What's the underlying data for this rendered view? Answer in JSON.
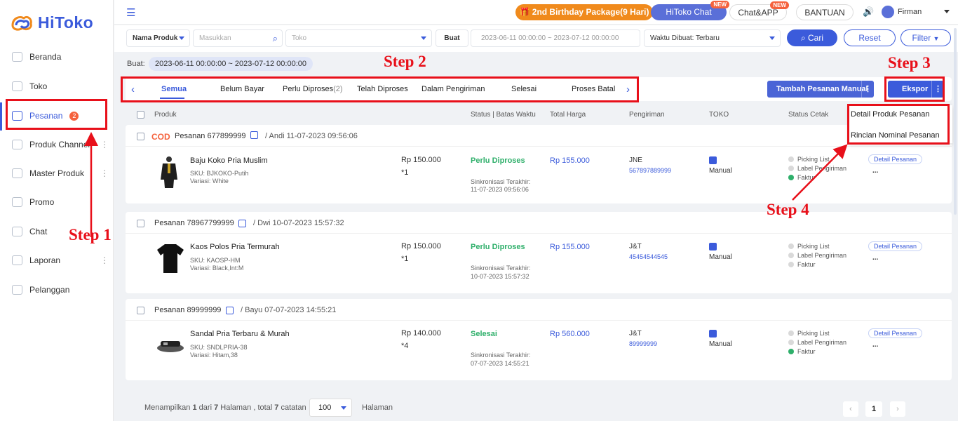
{
  "brand": {
    "name": "HiToko"
  },
  "sidebar": {
    "items": [
      {
        "label": "Beranda",
        "icon": "home-icon"
      },
      {
        "label": "Toko",
        "icon": "store-icon"
      },
      {
        "label": "Pesanan",
        "icon": "orders-icon",
        "badge": "2",
        "active": true
      },
      {
        "label": "Produk Channel",
        "icon": "grid-icon",
        "more": "⋮"
      },
      {
        "label": "Master Produk",
        "icon": "box-icon",
        "more": "⋮"
      },
      {
        "label": "Promo",
        "icon": "promo-icon"
      },
      {
        "label": "Chat",
        "icon": "chat-icon"
      },
      {
        "label": "Laporan",
        "icon": "report-icon",
        "more": "⋮"
      },
      {
        "label": "Pelanggan",
        "icon": "users-icon"
      }
    ]
  },
  "topbar": {
    "birthday": "2nd Birthday Package(9 Hari)",
    "chat": "HiToko Chat",
    "chatapp": "Chat&APP",
    "bantuan": "BANTUAN",
    "new_tag": "NEW",
    "user": "Firman"
  },
  "filters": {
    "field_select": "Nama Produk",
    "search_placeholder": "Masukkan",
    "toko_placeholder": "Toko",
    "date_label": "Buat",
    "date_start": "2023-06-11 00:00:00",
    "date_sep": "~",
    "date_end": "2023-07-12 00:00:00",
    "sort": "Waktu Dibuat: Terbaru",
    "cari": "Cari",
    "reset": "Reset",
    "filter": "Filter"
  },
  "active_filter": {
    "label": "Buat:",
    "value": "2023-06-11 00:00:00 ~ 2023-07-12 00:00:00"
  },
  "tabs": [
    {
      "label": "Semua"
    },
    {
      "label": "Belum Bayar"
    },
    {
      "label": "Perlu Diproses",
      "count": "(2)"
    },
    {
      "label": "Telah Diproses"
    },
    {
      "label": "Dalam Pengiriman"
    },
    {
      "label": "Selesai"
    },
    {
      "label": "Proses Batal"
    }
  ],
  "actions": {
    "manual": "Tambah Pesanan Manual",
    "ekspor": "Ekspor",
    "more": "⋮"
  },
  "export_menu": [
    "Detail Produk Pesanan",
    "Rincian Nominal Pesanan"
  ],
  "columns": {
    "produk": "Produk",
    "status": "Status | Batas Waktu",
    "total": "Total Harga",
    "pengiriman": "Pengiriman",
    "toko": "TOKO",
    "cetak": "Status Cetak"
  },
  "orders": [
    {
      "cod": "COD",
      "order_label": "Pesanan 677899999",
      "meta": "/ Andi 11-07-2023 09:56:06",
      "product": "Baju Koko Pria Muslim",
      "sku": "SKU:  BJKOKO-Putih",
      "variasi": "Variasi:  White",
      "price": "Rp 150.000",
      "qty": "*1",
      "status": "Perlu Diproses",
      "sync_label": "Sinkronisasi Terakhir:",
      "sync_time": "11-07-2023 09:56:06",
      "total": "Rp 155.000",
      "courier": "JNE",
      "tracking": "567897889999",
      "toko": "Manual",
      "print": [
        "Picking List",
        "Label Pengiriman",
        "Faktur"
      ],
      "detail": "Detail Pesanan",
      "more": "..."
    },
    {
      "cod": "",
      "order_label": "Pesanan 78967799999",
      "meta": "/ Dwi 10-07-2023 15:57:32",
      "product": "Kaos Polos Pria Termurah",
      "sku": "SKU:  KAOSP-HM",
      "variasi": "Variasi:  Black,Int:M",
      "price": "Rp 150.000",
      "qty": "*1",
      "status": "Perlu Diproses",
      "sync_label": "Sinkronisasi Terakhir:",
      "sync_time": "10-07-2023 15:57:32",
      "total": "Rp 155.000",
      "courier": "J&T",
      "tracking": "45454544545",
      "toko": "Manual",
      "print": [
        "Picking List",
        "Label Pengiriman",
        "Faktur"
      ],
      "detail": "Detail Pesanan",
      "more": "..."
    },
    {
      "cod": "",
      "order_label": "Pesanan 89999999",
      "meta": "/ Bayu 07-07-2023 14:55:21",
      "product": "Sandal Pria Terbaru & Murah",
      "sku": "SKU:  SNDLPRIA-38",
      "variasi": "Variasi:  Hitam,38",
      "price": "Rp 140.000",
      "qty": "*4",
      "status": "Selesai",
      "sync_label": "Sinkronisasi Terakhir:",
      "sync_time": "07-07-2023 14:55:21",
      "total": "Rp 560.000",
      "courier": "J&T",
      "tracking": "89999999",
      "toko": "Manual",
      "print": [
        "Picking List",
        "Label Pengiriman",
        "Faktur"
      ],
      "detail": "Detail Pesanan",
      "more": "..."
    }
  ],
  "footer": {
    "summary_prefix": "Menampilkan ",
    "page": "1",
    "mid": " dari ",
    "pages": "7",
    "mid2": " Halaman , total ",
    "total": "7",
    "suffix": " catatan",
    "page_size": "100",
    "halaman": "Halaman",
    "current_page": "1"
  },
  "annotations": {
    "step1": "Step 1",
    "step2": "Step 2",
    "step3": "Step 3",
    "step4": "Step 4"
  },
  "colors": {
    "primary": "#3b5bdb",
    "orange": "#f08a1c",
    "success": "#2eaf6a",
    "annotation": "#e8101a"
  }
}
